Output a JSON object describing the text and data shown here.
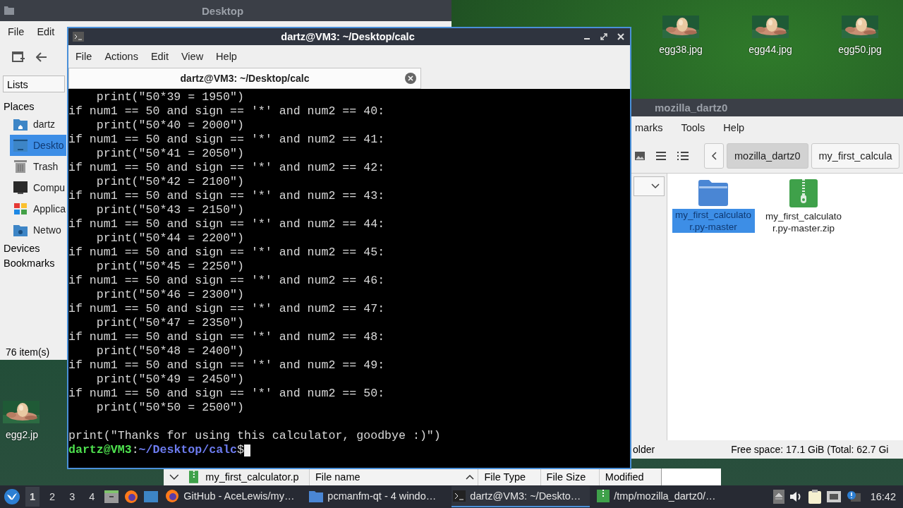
{
  "desktop_icons": [
    {
      "label": "egg38.jpg",
      "kind": "picture"
    },
    {
      "label": "egg44.jpg",
      "kind": "picture"
    },
    {
      "label": "egg50.jpg",
      "kind": "picture"
    },
    {
      "label": "egg2.jp",
      "kind": "picture"
    }
  ],
  "desktop_window": {
    "title": "Desktop",
    "menu": [
      "File",
      "Edit"
    ],
    "view_label": "Lists",
    "places_header": "Places",
    "places": [
      {
        "label": "dartz",
        "kind": "home",
        "selected": false
      },
      {
        "label": "Deskto",
        "kind": "desktop",
        "selected": true
      },
      {
        "label": "Trash",
        "kind": "trash",
        "selected": false
      },
      {
        "label": "Compu",
        "kind": "computer",
        "selected": false
      },
      {
        "label": "Applica",
        "kind": "apps",
        "selected": false
      },
      {
        "label": "Netwo",
        "kind": "network",
        "selected": false
      }
    ],
    "sections": [
      "Devices",
      "Bookmarks"
    ],
    "status": "76 item(s)"
  },
  "terminal": {
    "title": "dartz@VM3: ~/Desktop/calc",
    "menu": [
      "File",
      "Actions",
      "Edit",
      "View",
      "Help"
    ],
    "tab_title": "dartz@VM3: ~/Desktop/calc",
    "lines": [
      {
        "kind": "code",
        "text": "    print(\"50*39 = 1950\")"
      },
      {
        "kind": "code",
        "text": "if num1 == 50 and sign == '*' and num2 == 40:"
      },
      {
        "kind": "code",
        "text": "    print(\"50*40 = 2000\")"
      },
      {
        "kind": "code",
        "text": "if num1 == 50 and sign == '*' and num2 == 41:"
      },
      {
        "kind": "code",
        "text": "    print(\"50*41 = 2050\")"
      },
      {
        "kind": "code",
        "text": "if num1 == 50 and sign == '*' and num2 == 42:"
      },
      {
        "kind": "code",
        "text": "    print(\"50*42 = 2100\")"
      },
      {
        "kind": "code",
        "text": "if num1 == 50 and sign == '*' and num2 == 43:"
      },
      {
        "kind": "code",
        "text": "    print(\"50*43 = 2150\")"
      },
      {
        "kind": "code",
        "text": "if num1 == 50 and sign == '*' and num2 == 44:"
      },
      {
        "kind": "code",
        "text": "    print(\"50*44 = 2200\")"
      },
      {
        "kind": "code",
        "text": "if num1 == 50 and sign == '*' and num2 == 45:"
      },
      {
        "kind": "code",
        "text": "    print(\"50*45 = 2250\")"
      },
      {
        "kind": "code",
        "text": "if num1 == 50 and sign == '*' and num2 == 46:"
      },
      {
        "kind": "code",
        "text": "    print(\"50*46 = 2300\")"
      },
      {
        "kind": "code",
        "text": "if num1 == 50 and sign == '*' and num2 == 47:"
      },
      {
        "kind": "code",
        "text": "    print(\"50*47 = 2350\")"
      },
      {
        "kind": "code",
        "text": "if num1 == 50 and sign == '*' and num2 == 48:"
      },
      {
        "kind": "code",
        "text": "    print(\"50*48 = 2400\")"
      },
      {
        "kind": "code",
        "text": "if num1 == 50 and sign == '*' and num2 == 49:"
      },
      {
        "kind": "code",
        "text": "    print(\"50*49 = 2450\")"
      },
      {
        "kind": "code",
        "text": "if num1 == 50 and sign == '*' and num2 == 50:"
      },
      {
        "kind": "code",
        "text": "    print(\"50*50 = 2500\")"
      },
      {
        "kind": "blank"
      },
      {
        "kind": "code",
        "text": "print(\"Thanks for using this calculator, goodbye :)\")"
      }
    ],
    "prompt": {
      "user_host": "dartz@VM3",
      "separator": ":",
      "path": "~/Desktop/calc",
      "symbol": "$"
    }
  },
  "files_window": {
    "title": "mozilla_dartz0",
    "menu": [
      "marks",
      "Tools",
      "Help"
    ],
    "path_buttons": [
      {
        "label": "mozilla_dartz0",
        "selected": true
      },
      {
        "label": "my_first_calcula",
        "selected": false
      }
    ],
    "files": [
      {
        "name": "my_first_calculator.py-master",
        "kind": "folder",
        "selected": true
      },
      {
        "name": "my_first_calculator.py-master.zip",
        "kind": "zip",
        "selected": false
      }
    ],
    "status_left": "older",
    "status_right": "Free space: 17.1 GiB (Total: 62.7 Gi"
  },
  "list_window": {
    "file": "my_first_calculator.p",
    "columns": [
      "File name",
      "File Type",
      "File Size",
      "Modified"
    ]
  },
  "taskbar": {
    "workspaces": [
      {
        "label": "1",
        "selected": true
      },
      {
        "label": "2",
        "selected": false
      },
      {
        "label": "3",
        "selected": false
      },
      {
        "label": "4",
        "selected": false
      }
    ],
    "tasks": [
      {
        "label": "GitHub - AceLewis/my…",
        "kind": "firefox",
        "selected": false
      },
      {
        "label": "pcmanfm-qt - 4 windo…",
        "kind": "folder",
        "selected": false
      },
      {
        "label": "dartz@VM3: ~/Deskto…",
        "kind": "terminal",
        "selected": true
      },
      {
        "label": "/tmp/mozilla_dartz0/…",
        "kind": "zip",
        "selected": false
      }
    ],
    "clock": "16:42"
  }
}
